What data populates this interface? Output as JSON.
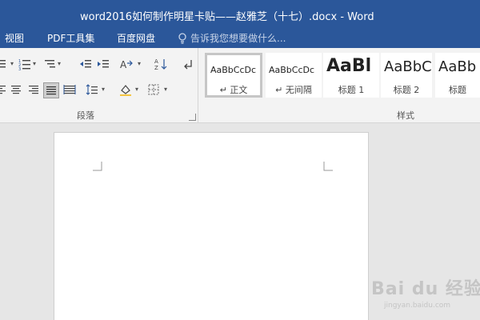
{
  "window": {
    "title": "word2016如何制作明星卡贴——赵雅芝（十七）.docx - Word"
  },
  "menu": {
    "tabs": [
      "视图",
      "PDF工具集",
      "百度网盘"
    ],
    "search_placeholder": "告诉我您想要做什么..."
  },
  "ribbon": {
    "paragraph_group_label": "段落",
    "styles_group_label": "样式",
    "styles": [
      {
        "preview": "AaBbCcDc",
        "name": "↵ 正文"
      },
      {
        "preview": "AaBbCcDc",
        "name": "↵ 无间隔"
      },
      {
        "preview": "AaBl",
        "name": "标题 1"
      },
      {
        "preview": "AaBbC",
        "name": "标题 2"
      },
      {
        "preview": "AaBb",
        "name": "标题"
      }
    ]
  },
  "watermark": {
    "main": "Bai du 经验",
    "sub": "jingyan.baidu.com"
  },
  "colors": {
    "title_bar": "#2b579a",
    "ribbon": "#f3f3f3",
    "canvas": "#e6e6e6",
    "page": "#ffffff"
  }
}
